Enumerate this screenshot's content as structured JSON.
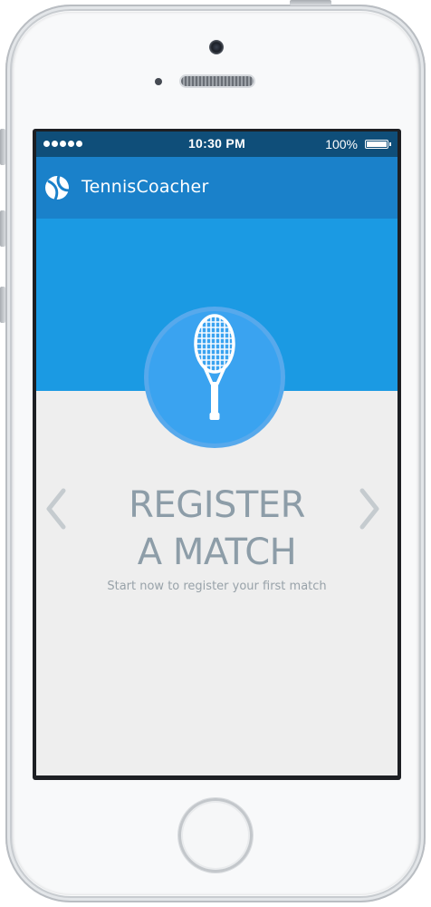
{
  "status_bar": {
    "time": "10:30 PM",
    "battery": "100%",
    "signal_icon": "signal-dots-icon",
    "battery_icon": "battery-full-icon"
  },
  "app_bar": {
    "logo_icon": "tennis-ball-icon",
    "title": "TennisCoacher"
  },
  "hero": {
    "icon": "tennis-racket-icon"
  },
  "slide": {
    "headline_line1": "REGISTER",
    "headline_line2": "A MATCH",
    "subtitle": "Start now to register your first match"
  },
  "navigation": {
    "prev_icon": "chevron-left-icon",
    "next_icon": "chevron-right-icon"
  },
  "colors": {
    "status_bar": "#0f4e79",
    "app_bar": "#1a81ca",
    "hero": "#1b9ae3",
    "content_bg": "#eeeeee",
    "headline": "#8d9da8",
    "arrow": "#c5cbcf"
  }
}
